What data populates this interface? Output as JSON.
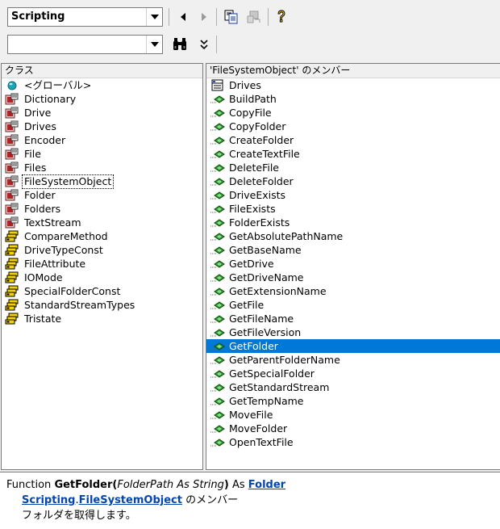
{
  "toolbar": {
    "library_combo": {
      "value": "Scripting"
    },
    "search_combo": {
      "value": ""
    }
  },
  "left_pane": {
    "header": "クラス",
    "items": [
      {
        "label": "<グローバル>",
        "icon": "globe-icon",
        "kind": "global"
      },
      {
        "label": "Dictionary",
        "icon": "class-icon",
        "kind": "class"
      },
      {
        "label": "Drive",
        "icon": "class-icon",
        "kind": "class"
      },
      {
        "label": "Drives",
        "icon": "class-icon",
        "kind": "class"
      },
      {
        "label": "Encoder",
        "icon": "class-icon",
        "kind": "class"
      },
      {
        "label": "File",
        "icon": "class-icon",
        "kind": "class"
      },
      {
        "label": "Files",
        "icon": "class-icon",
        "kind": "class"
      },
      {
        "label": "FileSystemObject",
        "icon": "class-icon",
        "kind": "class",
        "focused": true
      },
      {
        "label": "Folder",
        "icon": "class-icon",
        "kind": "class"
      },
      {
        "label": "Folders",
        "icon": "class-icon",
        "kind": "class"
      },
      {
        "label": "TextStream",
        "icon": "class-icon",
        "kind": "class"
      },
      {
        "label": "CompareMethod",
        "icon": "enum-icon",
        "kind": "enum"
      },
      {
        "label": "DriveTypeConst",
        "icon": "enum-icon",
        "kind": "enum"
      },
      {
        "label": "FileAttribute",
        "icon": "enum-icon",
        "kind": "enum"
      },
      {
        "label": "IOMode",
        "icon": "enum-icon",
        "kind": "enum"
      },
      {
        "label": "SpecialFolderConst",
        "icon": "enum-icon",
        "kind": "enum"
      },
      {
        "label": "StandardStreamTypes",
        "icon": "enum-icon",
        "kind": "enum"
      },
      {
        "label": "Tristate",
        "icon": "enum-icon",
        "kind": "enum"
      }
    ]
  },
  "right_pane": {
    "header": "'FileSystemObject' のメンバー",
    "items": [
      {
        "label": "Drives",
        "icon": "property-icon",
        "kind": "property"
      },
      {
        "label": "BuildPath",
        "icon": "method-icon",
        "kind": "method"
      },
      {
        "label": "CopyFile",
        "icon": "method-icon",
        "kind": "method"
      },
      {
        "label": "CopyFolder",
        "icon": "method-icon",
        "kind": "method"
      },
      {
        "label": "CreateFolder",
        "icon": "method-icon",
        "kind": "method"
      },
      {
        "label": "CreateTextFile",
        "icon": "method-icon",
        "kind": "method"
      },
      {
        "label": "DeleteFile",
        "icon": "method-icon",
        "kind": "method"
      },
      {
        "label": "DeleteFolder",
        "icon": "method-icon",
        "kind": "method"
      },
      {
        "label": "DriveExists",
        "icon": "method-icon",
        "kind": "method"
      },
      {
        "label": "FileExists",
        "icon": "method-icon",
        "kind": "method"
      },
      {
        "label": "FolderExists",
        "icon": "method-icon",
        "kind": "method"
      },
      {
        "label": "GetAbsolutePathName",
        "icon": "method-icon",
        "kind": "method"
      },
      {
        "label": "GetBaseName",
        "icon": "method-icon",
        "kind": "method"
      },
      {
        "label": "GetDrive",
        "icon": "method-icon",
        "kind": "method"
      },
      {
        "label": "GetDriveName",
        "icon": "method-icon",
        "kind": "method"
      },
      {
        "label": "GetExtensionName",
        "icon": "method-icon",
        "kind": "method"
      },
      {
        "label": "GetFile",
        "icon": "method-icon",
        "kind": "method"
      },
      {
        "label": "GetFileName",
        "icon": "method-icon",
        "kind": "method"
      },
      {
        "label": "GetFileVersion",
        "icon": "method-icon",
        "kind": "method"
      },
      {
        "label": "GetFolder",
        "icon": "method-icon",
        "kind": "method",
        "selected": true
      },
      {
        "label": "GetParentFolderName",
        "icon": "method-icon",
        "kind": "method"
      },
      {
        "label": "GetSpecialFolder",
        "icon": "method-icon",
        "kind": "method"
      },
      {
        "label": "GetStandardStream",
        "icon": "method-icon",
        "kind": "method"
      },
      {
        "label": "GetTempName",
        "icon": "method-icon",
        "kind": "method"
      },
      {
        "label": "MoveFile",
        "icon": "method-icon",
        "kind": "method"
      },
      {
        "label": "MoveFolder",
        "icon": "method-icon",
        "kind": "method"
      },
      {
        "label": "OpenTextFile",
        "icon": "method-icon",
        "kind": "method"
      }
    ]
  },
  "detail": {
    "keyword": "Function",
    "name": "GetFolder",
    "paren_open": "(",
    "params": "FolderPath As String",
    "paren_close": ")",
    "as_word": "As",
    "return_type": "Folder",
    "library": "Scripting",
    "dot": ".",
    "class": "FileSystemObject",
    "member_of": "のメンバー",
    "description": "フォルダを取得します。"
  },
  "colors": {
    "selection": "#0078d7",
    "link": "#0645ad",
    "method_green": "#2e9a2e",
    "class_red": "#b22222"
  }
}
